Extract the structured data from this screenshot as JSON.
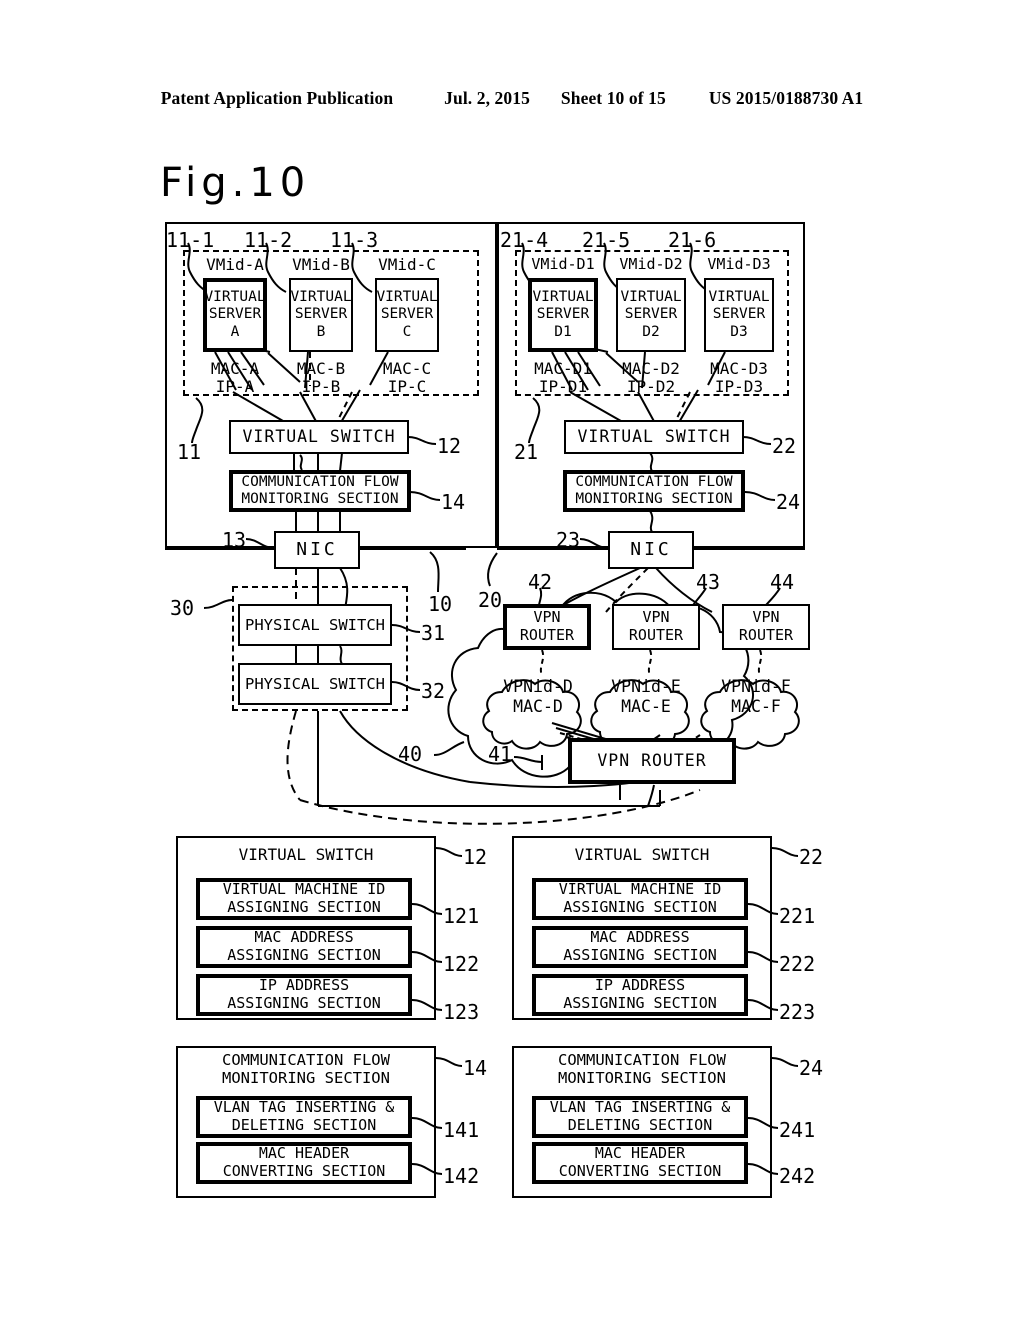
{
  "header": {
    "publication": "Patent Application Publication",
    "date": "Jul. 2, 2015",
    "sheet": "Sheet 10 of 15",
    "patent_number": "US 2015/0188730 A1"
  },
  "figure": {
    "title": "Fig.10"
  },
  "system_left": {
    "outer_ref": "10",
    "vm_group_ref": "11",
    "vm_group_dash_label": "",
    "virtual_machines": [
      {
        "ref": "11-1",
        "vmid": "VMid-A",
        "name": "VIRTUAL\nSERVER\nA",
        "mac": "MAC-A",
        "ip": "IP-A"
      },
      {
        "ref": "11-2",
        "vmid": "VMid-B",
        "name": "VIRTUAL\nSERVER\nB",
        "mac": "MAC-B",
        "ip": "IP-B"
      },
      {
        "ref": "11-3",
        "vmid": "VMid-C",
        "name": "VIRTUAL\nSERVER\nC",
        "mac": "MAC-C",
        "ip": "IP-C"
      }
    ],
    "virtual_switch": {
      "label": "VIRTUAL SWITCH",
      "ref": "12"
    },
    "comm_flow": {
      "label": "COMMUNICATION FLOW\nMONITORING SECTION",
      "ref": "14"
    },
    "nic": {
      "label": "NIC",
      "ref": "13"
    }
  },
  "system_right": {
    "outer_ref": "20",
    "vm_group_ref": "21",
    "virtual_machines": [
      {
        "ref": "21-4",
        "vmid": "VMid-D1",
        "name": "VIRTUAL\nSERVER\nD1",
        "mac": "MAC-D1",
        "ip": "IP-D1"
      },
      {
        "ref": "21-5",
        "vmid": "VMid-D2",
        "name": "VIRTUAL\nSERVER\nD2",
        "mac": "MAC-D2",
        "ip": "IP-D2"
      },
      {
        "ref": "21-6",
        "vmid": "VMid-D3",
        "name": "VIRTUAL\nSERVER\nD3",
        "mac": "MAC-D3",
        "ip": "IP-D3"
      }
    ],
    "virtual_switch": {
      "label": "VIRTUAL SWITCH",
      "ref": "22"
    },
    "comm_flow": {
      "label": "COMMUNICATION FLOW\nMONITORING SECTION",
      "ref": "24"
    },
    "nic": {
      "label": "NIC",
      "ref": "23"
    }
  },
  "physical_network": {
    "group_ref": "30",
    "switches": [
      {
        "label": "PHYSICAL SWITCH",
        "ref": "31"
      },
      {
        "label": "PHYSICAL SWITCH",
        "ref": "32"
      }
    ]
  },
  "vpn_cloud": {
    "cloud_ref": "40",
    "routers": [
      {
        "label": "VPN\nROUTER",
        "ref": "42"
      },
      {
        "label": "VPN\nROUTER",
        "ref": "43"
      },
      {
        "label": "VPN\nROUTER",
        "ref": "44"
      }
    ],
    "subclouds": [
      {
        "vpnid": "VPNid-D",
        "mac": "MAC-D"
      },
      {
        "vpnid": "VPNid-E",
        "mac": "MAC-E"
      },
      {
        "vpnid": "VPNid-F",
        "mac": "MAC-F"
      }
    ],
    "main_router": {
      "label": "VPN ROUTER",
      "ref": "41"
    }
  },
  "detail_panels": [
    {
      "title": "VIRTUAL SWITCH",
      "ref": "12",
      "sections": [
        {
          "label": "VIRTUAL MACHINE ID\nASSIGNING SECTION",
          "ref": "121",
          "thick": true
        },
        {
          "label": "MAC ADDRESS\nASSIGNING SECTION",
          "ref": "122",
          "thick": true
        },
        {
          "label": "IP ADDRESS\nASSIGNING SECTION",
          "ref": "123",
          "thick": true
        }
      ]
    },
    {
      "title": "VIRTUAL SWITCH",
      "ref": "22",
      "sections": [
        {
          "label": "VIRTUAL MACHINE ID\nASSIGNING SECTION",
          "ref": "221",
          "thick": true
        },
        {
          "label": "MAC ADDRESS\nASSIGNING SECTION",
          "ref": "222",
          "thick": true
        },
        {
          "label": "IP ADDRESS\nASSIGNING SECTION",
          "ref": "223",
          "thick": true
        }
      ]
    },
    {
      "title": "COMMUNICATION FLOW\nMONITORING SECTION",
      "ref": "14",
      "sections": [
        {
          "label": "VLAN TAG INSERTING &\nDELETING SECTION",
          "ref": "141",
          "thick": true
        },
        {
          "label": "MAC HEADER\nCONVERTING SECTION",
          "ref": "142",
          "thick": true
        }
      ]
    },
    {
      "title": "COMMUNICATION FLOW\nMONITORING SECTION",
      "ref": "24",
      "sections": [
        {
          "label": "VLAN TAG INSERTING &\nDELETING SECTION",
          "ref": "241",
          "thick": true
        },
        {
          "label": "MAC HEADER\nCONVERTING SECTION",
          "ref": "242",
          "thick": true
        }
      ]
    }
  ]
}
